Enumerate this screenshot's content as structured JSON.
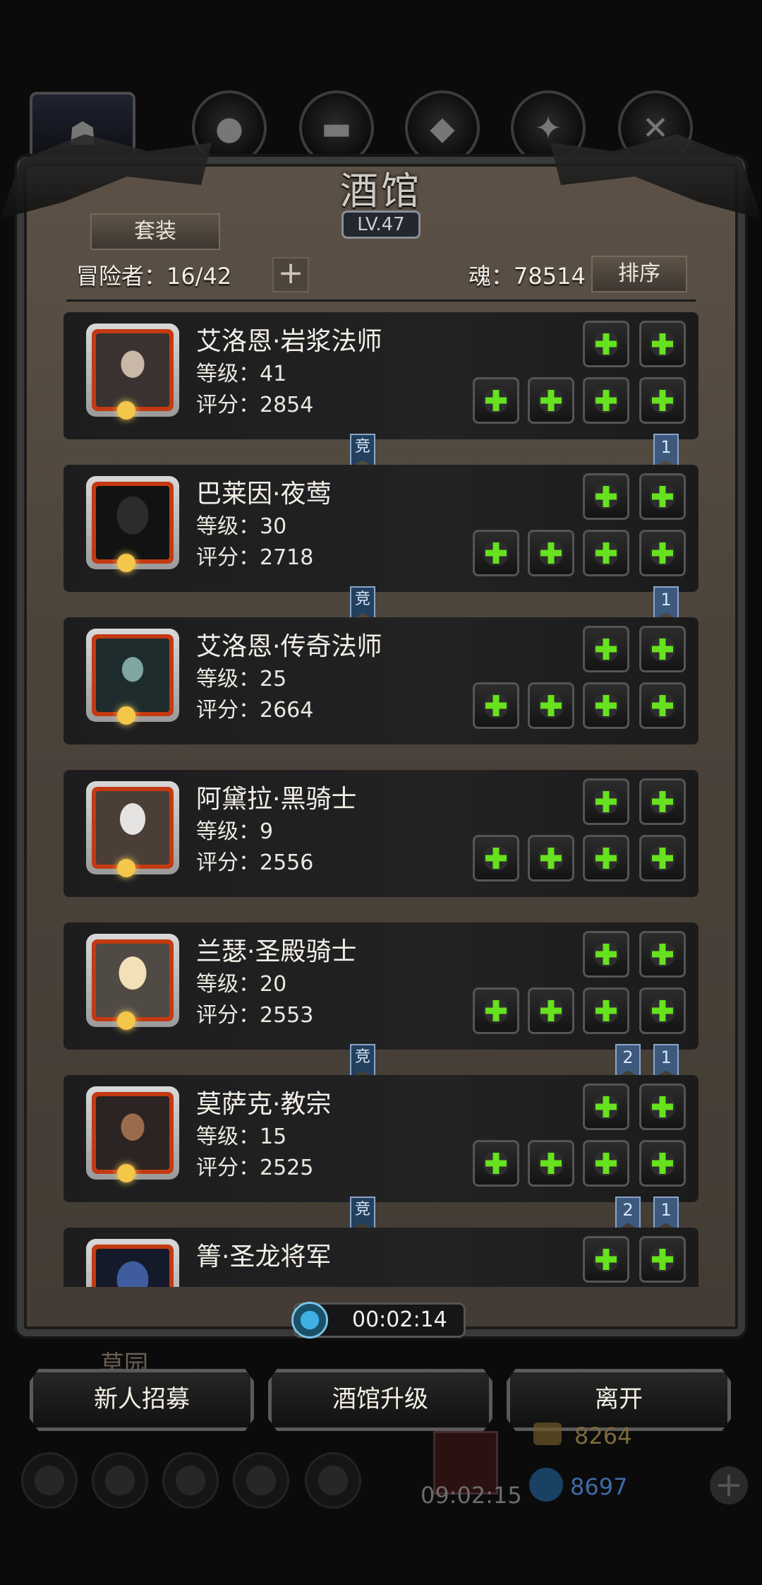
{
  "window": {
    "title": "酒馆",
    "level": "LV.47"
  },
  "header": {
    "set_label": "套装",
    "adventurers_label": "冒险者：16/42",
    "soul_label": "魂：78514",
    "sort_label": "排序",
    "add_symbol": "+"
  },
  "heroes": [
    {
      "name": "艾洛恩·岩浆法师",
      "level": "等级：41",
      "score": "评分：2854",
      "compete": "竞",
      "ribbons": [
        "1"
      ]
    },
    {
      "name": "巴莱因·夜莺",
      "level": "等级：30",
      "score": "评分：2718",
      "compete": "竞",
      "ribbons": [
        "1"
      ]
    },
    {
      "name": "艾洛恩·传奇法师",
      "level": "等级：25",
      "score": "评分：2664",
      "compete": "",
      "ribbons": []
    },
    {
      "name": "阿黛拉·黑骑士",
      "level": "等级：9",
      "score": "评分：2556",
      "compete": "",
      "ribbons": []
    },
    {
      "name": "兰瑟·圣殿骑士",
      "level": "等级：20",
      "score": "评分：2553",
      "compete": "竞",
      "ribbons": [
        "2",
        "1"
      ]
    },
    {
      "name": "莫萨克·教宗",
      "level": "等级：15",
      "score": "评分：2525",
      "compete": "竞",
      "ribbons": [
        "2",
        "1"
      ]
    },
    {
      "name": "箐·圣龙将军",
      "level": "",
      "score": "",
      "compete": "",
      "ribbons": []
    }
  ],
  "timer": "00:02:14",
  "actions": {
    "recruit": "新人招募",
    "upgrade": "酒馆升级",
    "leave": "离开"
  },
  "background": {
    "garden_label": "草园",
    "gold": "8264",
    "gems": "8697",
    "clock": "09:02:15"
  }
}
